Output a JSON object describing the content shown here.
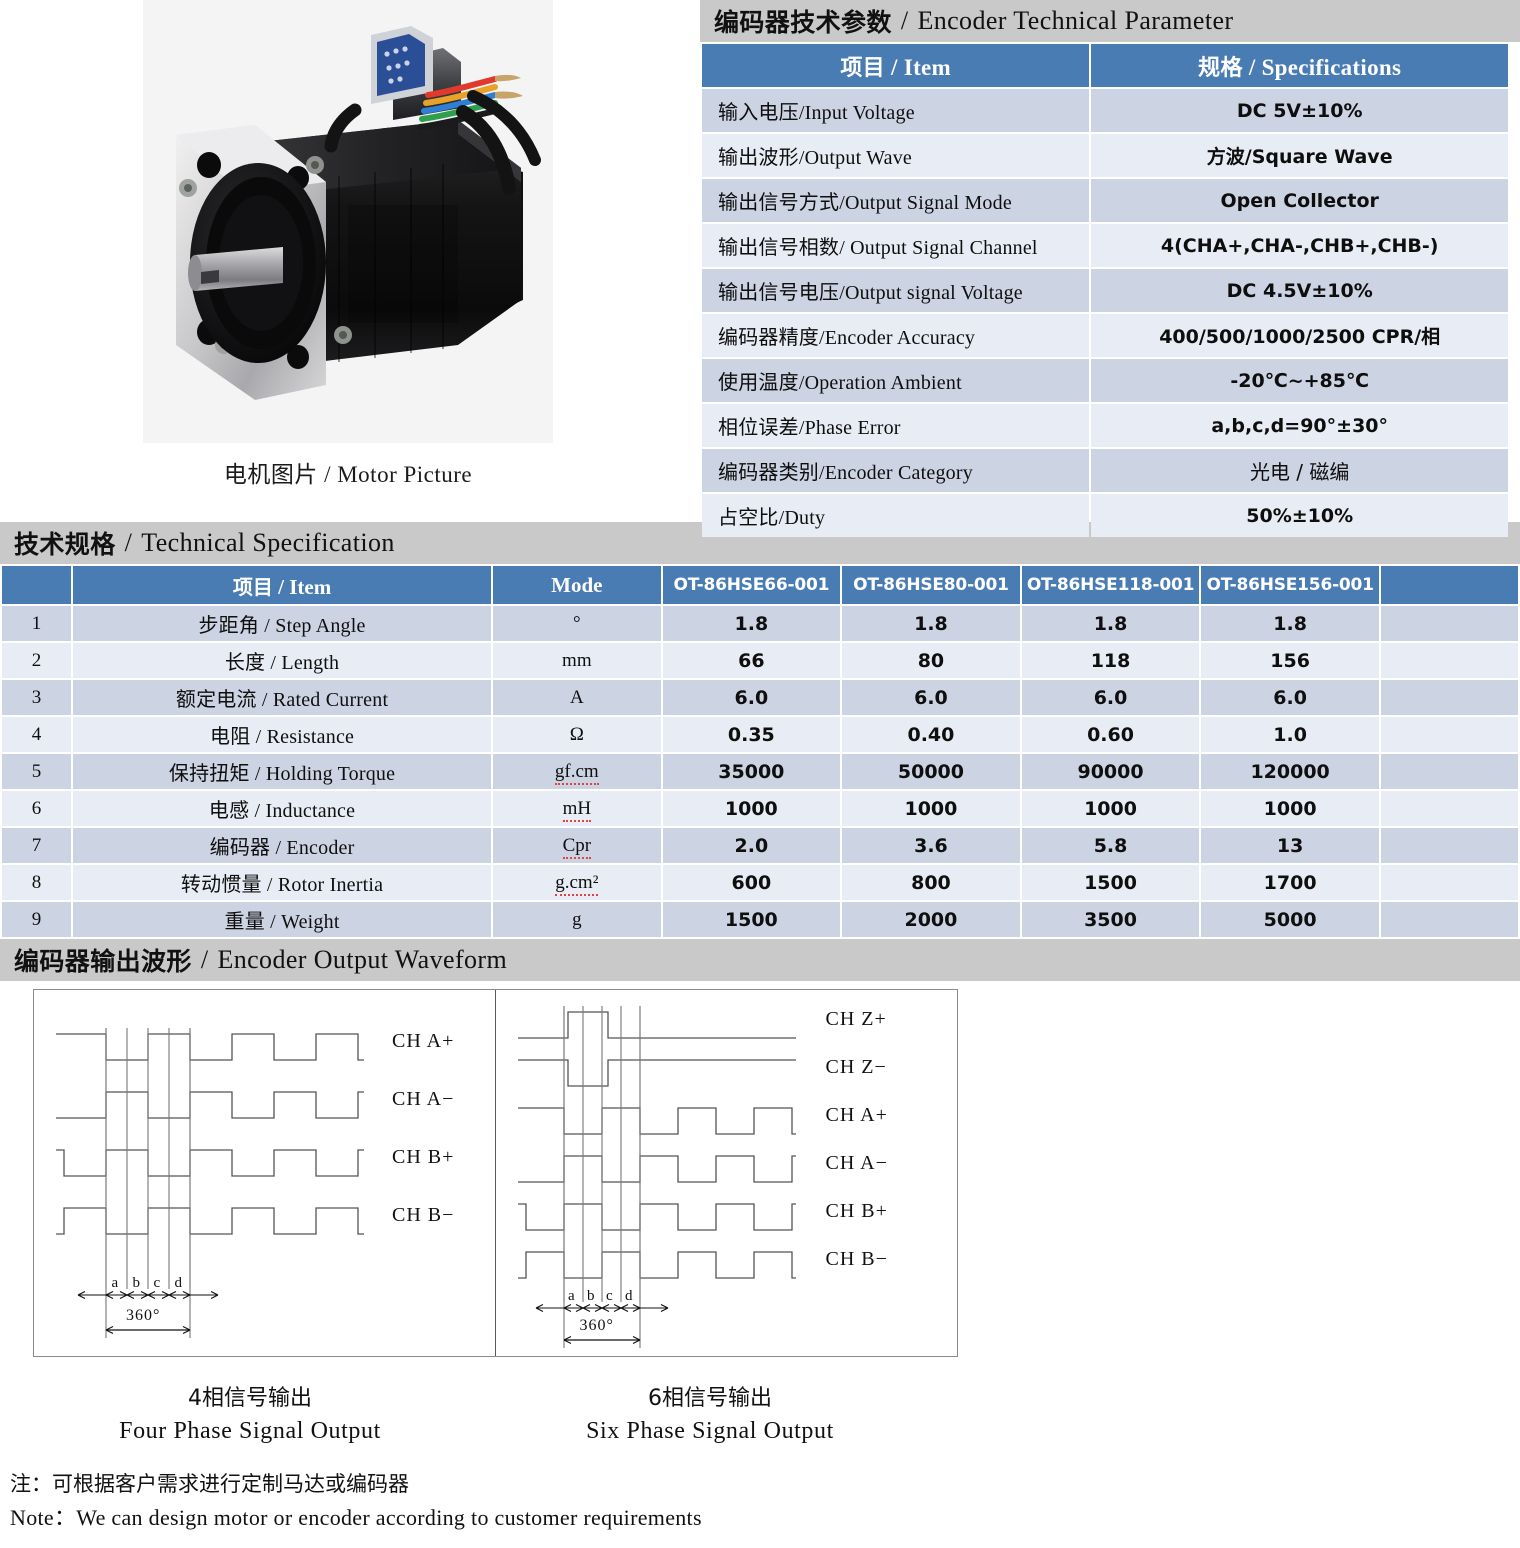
{
  "photo": {
    "caption_cn": "电机图片",
    "caption_sep": "/",
    "caption_en": "Motor Picture",
    "alt": "black NEMA 34 hybrid stepper motor with encoder, DB9 connector and colored lead wires"
  },
  "encoder": {
    "title_cn": "编码器技术参数",
    "title_sep": "/",
    "title_en": "Encoder Technical Parameter",
    "header": {
      "item_cn": "项目",
      "item_sep": "/",
      "item_en": "Item",
      "spec_cn": "规格",
      "spec_sep": "/",
      "spec_en": "Specifications"
    },
    "rows": [
      {
        "item_cn": "输入电压",
        "item_en": "Input Voltage",
        "spec": "DC 5V±10%",
        "spec_style": "bold"
      },
      {
        "item_cn": "输出波形",
        "item_en": "Output Wave",
        "spec": "方波/Square Wave",
        "spec_style": "mixed"
      },
      {
        "item_cn": "输出信号方式",
        "item_en": "Output Signal Mode",
        "spec": "Open Collector",
        "spec_style": "bold"
      },
      {
        "item_cn": "输出信号相数",
        "item_en": " Output Signal Channel",
        "spec": "4(CHA+,CHA-,CHB+,CHB-)",
        "spec_style": "bold"
      },
      {
        "item_cn": "输出信号电压",
        "item_en": "Output signal Voltage",
        "spec": "DC 4.5V±10%",
        "spec_style": "bold"
      },
      {
        "item_cn": "编码器精度",
        "item_en": "Encoder Accuracy",
        "spec": "400/500/1000/2500 CPR/相",
        "spec_style": "bold"
      },
      {
        "item_cn": "使用温度",
        "item_en": "Operation Ambient",
        "spec": "-20℃~+85℃",
        "spec_style": "bold"
      },
      {
        "item_cn": "相位误差",
        "item_en": "Phase Error",
        "spec": "a,b,c,d=90°±30°",
        "spec_style": "bold"
      },
      {
        "item_cn": "编码器类别",
        "item_en": "Encoder Category",
        "spec": "光电 / 磁编",
        "spec_style": "serif"
      },
      {
        "item_cn": "占空比",
        "item_en": "Duty",
        "spec": "50%±10%",
        "spec_style": "bold"
      }
    ]
  },
  "spec": {
    "title_cn": "技术规格",
    "title_sep": "/",
    "title_en": "Technical Specification",
    "header": {
      "index": "",
      "item_cn": "项目",
      "item_sep": "/",
      "item_en": "Item",
      "mode": "Mode",
      "models": [
        "OT-86HSE66-001",
        "OT-86HSE80-001",
        "OT-86HSE118-001",
        "OT-86HSE156-001"
      ],
      "trailing": ""
    },
    "rows": [
      {
        "no": "1",
        "cn": "步距角",
        "sep": "/",
        "en": "Step Angle",
        "mode": "°",
        "mode_flag": false,
        "values": [
          "1.8",
          "1.8",
          "1.8",
          "1.8"
        ]
      },
      {
        "no": "2",
        "cn": "长度",
        "sep": "/",
        "en": "Length",
        "mode": "mm",
        "mode_flag": false,
        "values": [
          "66",
          "80",
          "118",
          "156"
        ]
      },
      {
        "no": "3",
        "cn": "额定电流",
        "sep": "/",
        "en": "Rated Current",
        "mode": "A",
        "mode_flag": false,
        "values": [
          "6.0",
          "6.0",
          "6.0",
          "6.0"
        ]
      },
      {
        "no": "4",
        "cn": "电阻",
        "sep": "/",
        "en": "Resistance",
        "mode": "Ω",
        "mode_flag": false,
        "values": [
          "0.35",
          "0.40",
          "0.60",
          "1.0"
        ]
      },
      {
        "no": "5",
        "cn": "保持扭矩",
        "sep": "/",
        "en": "Holding Torque",
        "mode": "gf.cm",
        "mode_flag": true,
        "values": [
          "35000",
          "50000",
          "90000",
          "120000"
        ]
      },
      {
        "no": "6",
        "cn": "电感",
        "sep": "/",
        "en": "Inductance",
        "mode": "mH",
        "mode_flag": true,
        "values": [
          "1000",
          "1000",
          "1000",
          "1000"
        ]
      },
      {
        "no": "7",
        "cn": "编码器",
        "sep": "/",
        "en": "Encoder",
        "mode": "Cpr",
        "mode_flag": true,
        "values": [
          "2.0",
          "3.6",
          "5.8",
          "13"
        ]
      },
      {
        "no": "8",
        "cn": "转动惯量",
        "sep": "/",
        "en": "Rotor Inertia",
        "mode": "g.cm²",
        "mode_flag": true,
        "values": [
          "600",
          "800",
          "1500",
          "1700"
        ]
      },
      {
        "no": "9",
        "cn": "重量",
        "sep": "/",
        "en": "Weight",
        "mode": "g",
        "mode_flag": false,
        "values": [
          "1500",
          "2000",
          "3500",
          "5000"
        ]
      }
    ]
  },
  "waveform": {
    "title_cn": "编码器输出波形",
    "title_sep": "/",
    "title_en": "Encoder Output Waveform",
    "four_phase": {
      "channels": [
        "CH A+",
        "CH A−",
        "CH B+",
        "CH B−"
      ],
      "markers": [
        "a",
        "b",
        "c",
        "d"
      ],
      "period_label": "360°",
      "caption_cn": "4相信号输出",
      "caption_en": "Four Phase Signal Output"
    },
    "six_phase": {
      "channels": [
        "CH Z+",
        "CH Z−",
        "CH A+",
        "CH A−",
        "CH B+",
        "CH B−"
      ],
      "markers": [
        "a",
        "b",
        "c",
        "d"
      ],
      "period_label": "360°",
      "caption_cn": "6相信号输出",
      "caption_en": "Six Phase Signal Output"
    }
  },
  "notes": {
    "cn": "注：可根据客户需求进行定制马达或编码器",
    "en": "Note：We can design motor or encoder according to customer requirements"
  },
  "colors": {
    "header_blue": "#4a7cb4",
    "band_gray": "#c9c9c9",
    "row_dark": "#ccd3e3",
    "row_light": "#e8ecf4",
    "text": "#111111"
  }
}
